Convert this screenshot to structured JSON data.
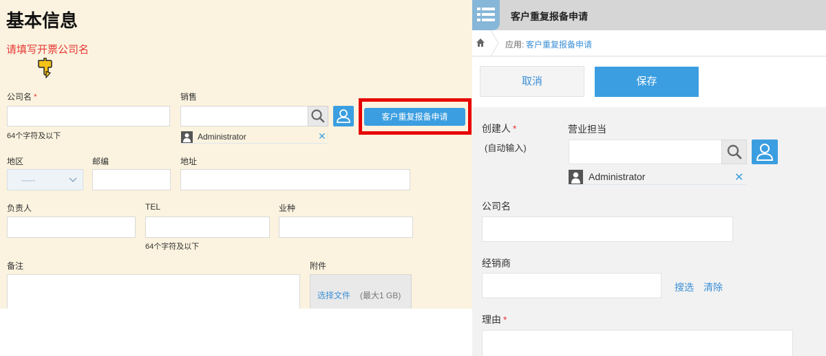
{
  "left": {
    "heading": "基本信息",
    "warning": "请填写开票公司名",
    "company_label": "公司名",
    "required_mark": "*",
    "company_hint": "64个字符及以下",
    "sales_label": "销售",
    "sales_user": "Administrator",
    "apply_button": "客户重复报备申请",
    "region_label": "地区",
    "region_value": "-----",
    "postcode_label": "邮编",
    "address_label": "地址",
    "owner_label": "负责人",
    "tel_label": "TEL",
    "tel_hint": "64个字符及以下",
    "industry_label": "业种",
    "remark_label": "备注",
    "attach_label": "附件",
    "select_file": "选择文件",
    "max_size": "(最大1 GB)",
    "colors": {
      "background": "#fbf3df",
      "accent": "#3b9ee0",
      "highlight": "#e60000",
      "warning": "#e53935"
    }
  },
  "right": {
    "title": "客户重复报备申请",
    "breadcrumb_prefix": "应用:",
    "breadcrumb_link": "客户重复报备申请",
    "cancel_button": "取消",
    "save_button": "保存",
    "creator_label": "创建人",
    "required_mark": "*",
    "auto_input": "(自动输入)",
    "sales_label": "营业担当",
    "sales_user": "Administrator",
    "company_label": "公司名",
    "dealer_label": "经销商",
    "search_link": "搜选",
    "clear_link": "清除",
    "reason_label": "理由",
    "colors": {
      "background": "#f2f2f2",
      "save": "#3b9ee0",
      "header": "#d6d6d6",
      "link": "#3b8fd6"
    }
  }
}
